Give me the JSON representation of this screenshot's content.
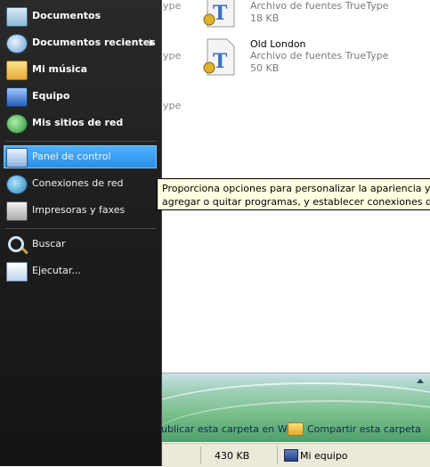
{
  "explorer": {
    "left_partial_types": [
      "ype",
      "ype",
      "ype"
    ],
    "files": [
      {
        "name": "",
        "type": "Archivo de fuentes TrueType",
        "size": "18 KB"
      },
      {
        "name": "Old London",
        "type": "Archivo de fuentes TrueType",
        "size": "50 KB"
      }
    ],
    "task_links": {
      "publish": "ublicar esta carpeta en Web",
      "share": "Compartir esta carpeta"
    },
    "statusbar": {
      "size": "430 KB",
      "location": "Mi equipo"
    }
  },
  "start_menu": {
    "items_top": [
      {
        "label": "Documentos",
        "icon": "documents-icon"
      },
      {
        "label": "Documentos recientes",
        "icon": "recent-documents-icon"
      },
      {
        "label": "Mi música",
        "icon": "my-music-icon"
      },
      {
        "label": "Equipo",
        "icon": "computer-icon"
      },
      {
        "label": "Mis sitios de red",
        "icon": "network-places-icon"
      }
    ],
    "items_middle": [
      {
        "label": "Panel de control",
        "icon": "control-panel-icon"
      },
      {
        "label": "Conexiones de red",
        "icon": "network-connections-icon"
      },
      {
        "label": "Impresoras y faxes",
        "icon": "printers-icon"
      }
    ],
    "items_bottom": [
      {
        "label": "Buscar",
        "icon": "search-icon"
      },
      {
        "label": "Ejecutar...",
        "icon": "run-icon"
      }
    ],
    "highlighted": "Panel de control"
  },
  "tooltip": {
    "line1": "Proporciona opciones para personalizar la apariencia y funcionalidad",
    "line2": "agregar o quitar programas, y establecer conexiones de red y cuentas"
  },
  "colors": {
    "highlight": "#3a9cf2",
    "menu_bg": "#1d1d1d",
    "tooltip_bg": "#ffffe1"
  }
}
